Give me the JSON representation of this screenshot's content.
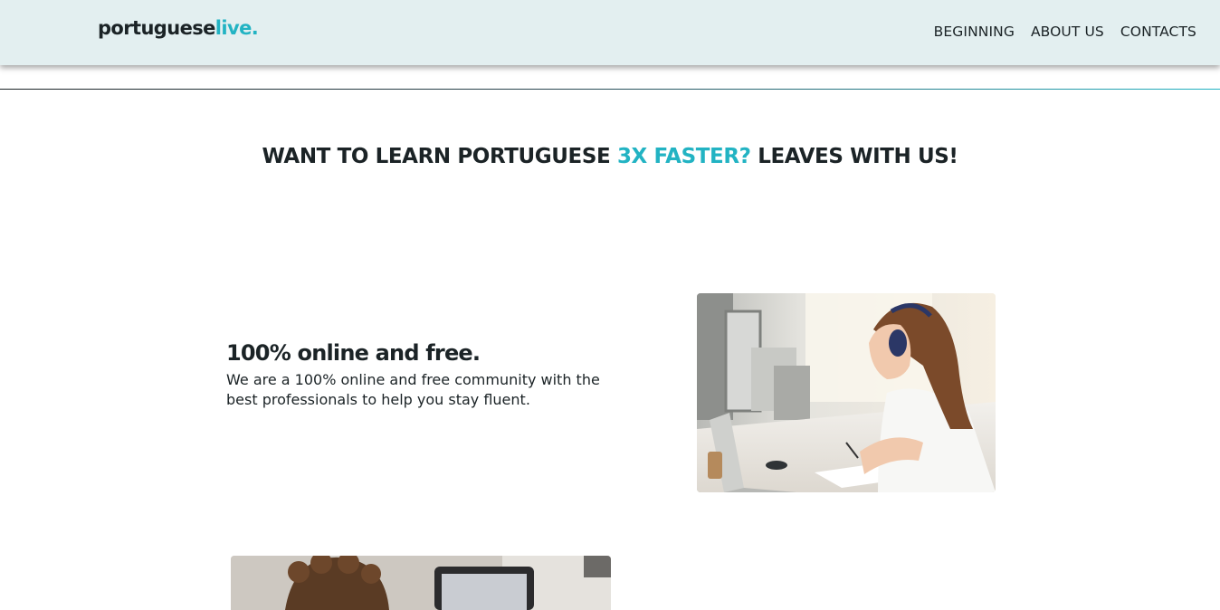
{
  "header": {
    "logo_main": "portuguese",
    "logo_accent": "live.",
    "nav": [
      {
        "label": "BEGINNING"
      },
      {
        "label": "ABOUT US"
      },
      {
        "label": "CONTACTS"
      }
    ]
  },
  "hero": {
    "headline_start": "WANT TO LEARN PORTUGUESE",
    "headline_accent": "3X FASTER?",
    "headline_end": "LEAVES WITH US!"
  },
  "feature": {
    "title": "100% online and free.",
    "text": "We are a 100% online and free community with the best professionals to help you stay fluent."
  },
  "colors": {
    "accent": "#22b3c3",
    "header_bg": "#e3eff0",
    "text": "#1b2326"
  }
}
